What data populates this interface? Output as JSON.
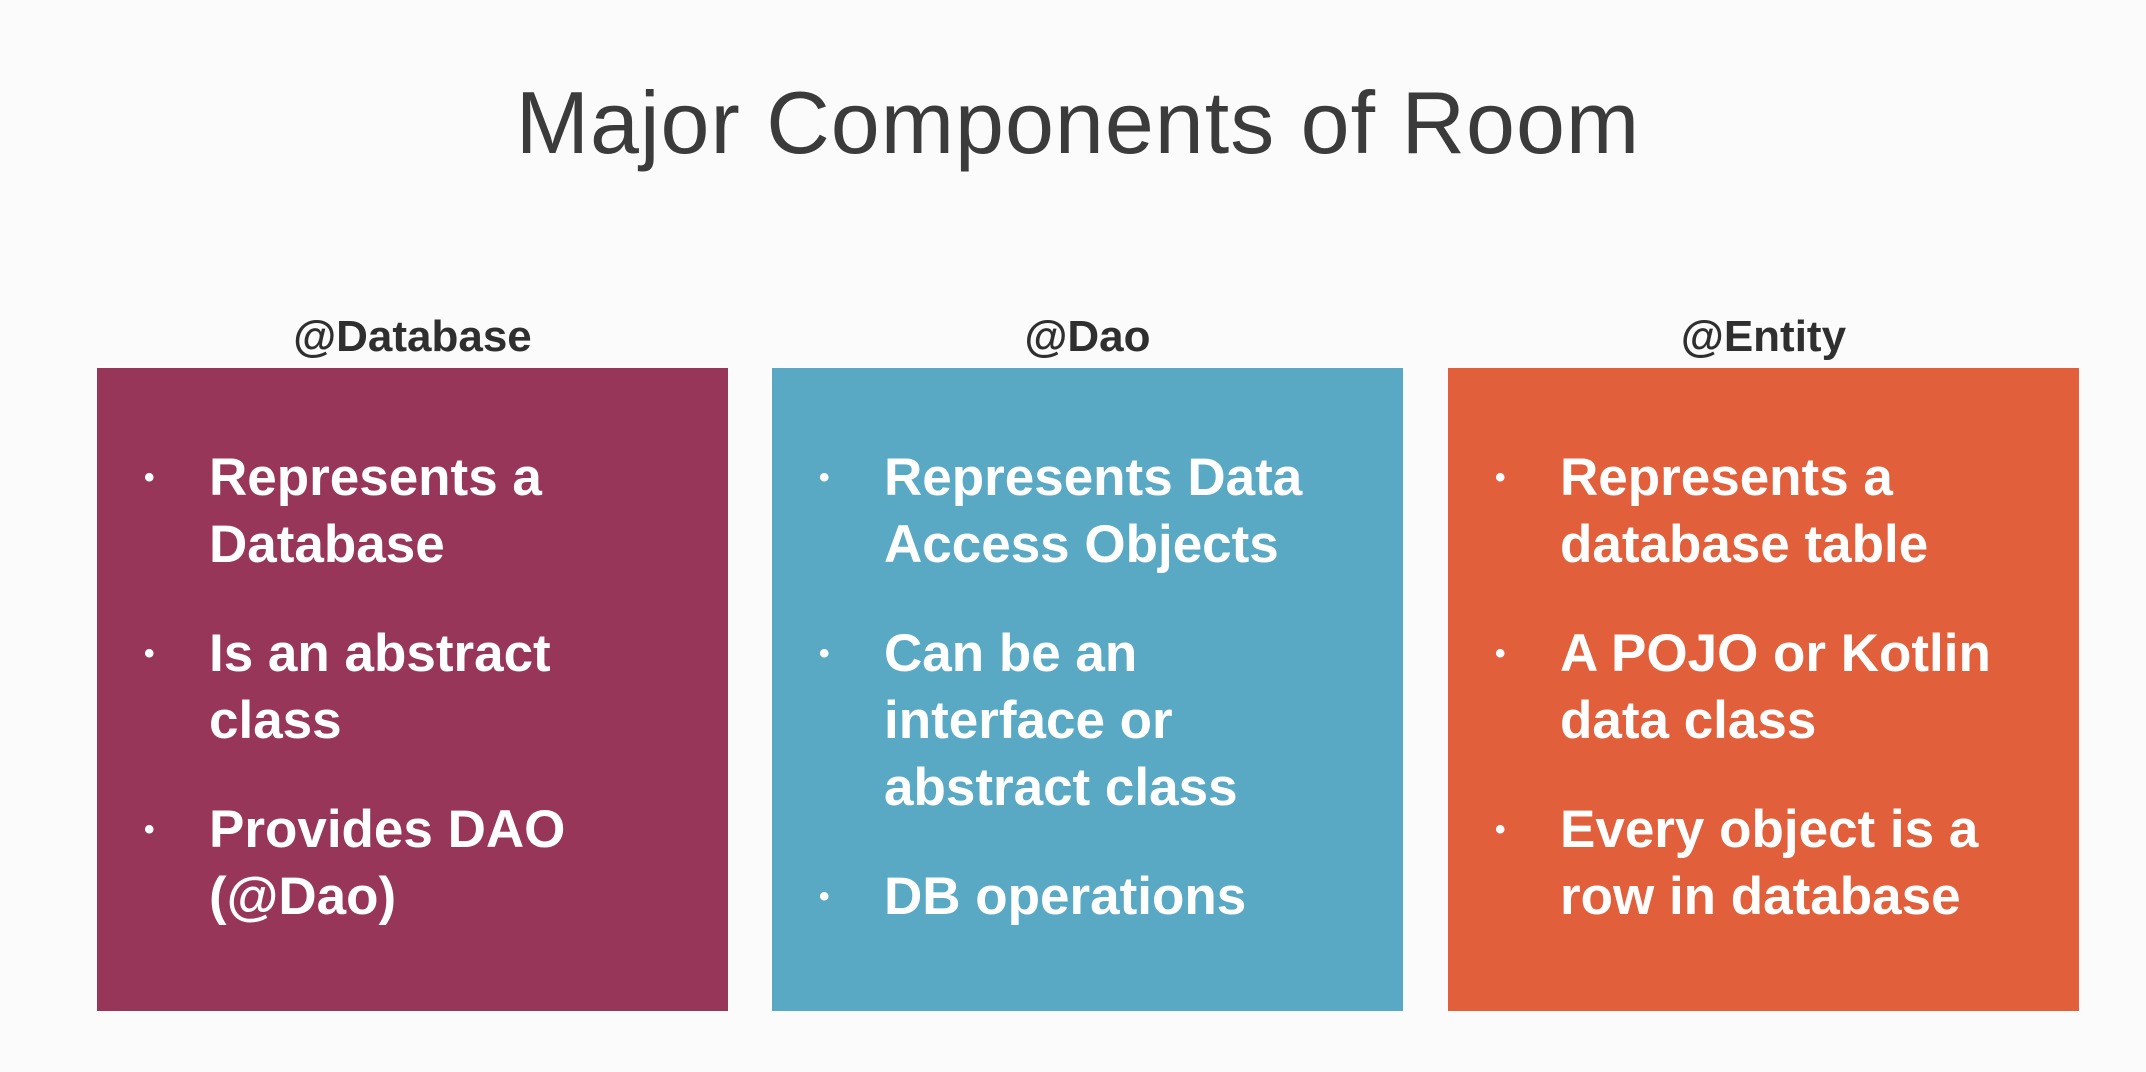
{
  "title": "Major Components of Room",
  "colors": {
    "database": "#98365a",
    "dao": "#59a9c5",
    "entity": "#e25f3b"
  },
  "columns": [
    {
      "heading": "@Database",
      "bullets": [
        "Represents a Database",
        "Is an abstract class",
        "Provides DAO (@Dao)"
      ]
    },
    {
      "heading": "@Dao",
      "bullets": [
        "Represents Data Access Objects",
        "Can be an interface or abstract class",
        "DB operations"
      ]
    },
    {
      "heading": "@Entity",
      "bullets": [
        "Represents a database table",
        "A POJO or Kotlin data class",
        "Every object is a row in database"
      ]
    }
  ]
}
